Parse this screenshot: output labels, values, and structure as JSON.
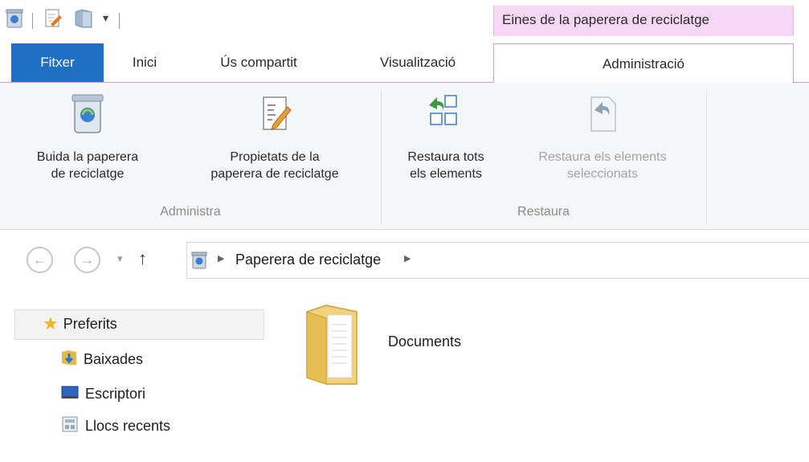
{
  "qat": {
    "icons": [
      "recycle-bin-icon",
      "properties-icon",
      "new-folder-icon",
      "customize-dropdown-icon"
    ]
  },
  "contextual_tab_header": "Eines de la paperera de reciclatge",
  "tabs": [
    {
      "label": "Fitxer"
    },
    {
      "label": "Inici"
    },
    {
      "label": "Ús compartit"
    },
    {
      "label": "Visualització"
    },
    {
      "label": "Administració"
    }
  ],
  "ribbon": {
    "groups": [
      {
        "label": "Administra",
        "buttons": [
          {
            "line1": "Buida la paperera",
            "line2": "de reciclatge",
            "icon": "recycle-bin-icon",
            "enabled": true
          },
          {
            "line1": "Propietats de la",
            "line2": "paperera de reciclatge",
            "icon": "properties-icon",
            "enabled": true
          }
        ]
      },
      {
        "label": "Restaura",
        "buttons": [
          {
            "line1": "Restaura tots",
            "line2": "els elements",
            "icon": "restore-all-icon",
            "enabled": true
          },
          {
            "line1": "Restaura els elements",
            "line2": "seleccionats",
            "icon": "restore-selected-icon",
            "enabled": false
          }
        ]
      }
    ]
  },
  "address": {
    "path": [
      "Paperera de reciclatge"
    ],
    "separator_icon": "chevron-right-icon"
  },
  "navpane": {
    "favorites_label": "Preferits",
    "items": [
      {
        "label": "Baixades",
        "icon": "downloads-icon"
      },
      {
        "label": "Escriptori",
        "icon": "desktop-icon"
      },
      {
        "label": "Llocs recents",
        "icon": "recent-places-icon"
      }
    ]
  },
  "content": {
    "items": [
      {
        "name": "Documents",
        "icon": "folder-icon"
      }
    ]
  },
  "colors": {
    "accent": "#1f6fc5",
    "contextual": "#f6d8f6",
    "contextual_border": "#d79ad7"
  }
}
